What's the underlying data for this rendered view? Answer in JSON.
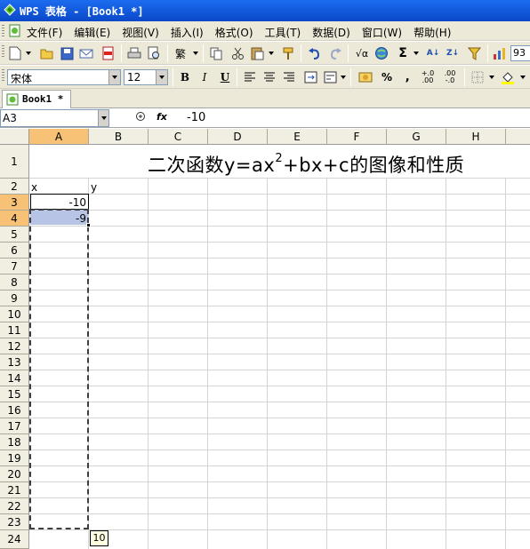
{
  "window": {
    "title": "WPS 表格 - [Book1 *]"
  },
  "menu": {
    "items": [
      "文件(F)",
      "编辑(E)",
      "视图(V)",
      "插入(I)",
      "格式(O)",
      "工具(T)",
      "数据(D)",
      "窗口(W)",
      "帮助(H)"
    ]
  },
  "toolbar": {
    "zoom": "93",
    "font_name": "宋体",
    "font_size": "12",
    "bold_label": "B",
    "italic_label": "I",
    "underline_label": "U",
    "percent_label": "%",
    "comma_label": "‚",
    "sum_label": "Σ",
    "sqrt_label": "√α",
    "lang_label": "繁"
  },
  "doc_tab": {
    "label": "Book1 *"
  },
  "formula_bar": {
    "name_box": "A3",
    "fx_label": "fx",
    "value": "-10"
  },
  "sheet": {
    "columns": [
      "A",
      "B",
      "C",
      "D",
      "E",
      "F",
      "G",
      "H"
    ],
    "selected_column": "A",
    "rows": [
      "1",
      "2",
      "3",
      "4",
      "5",
      "6",
      "7",
      "8",
      "9",
      "10",
      "11",
      "12",
      "13",
      "14",
      "15",
      "16",
      "17",
      "18",
      "19",
      "20",
      "21",
      "22",
      "23",
      "24"
    ],
    "selected_rows": [
      "3",
      "4"
    ],
    "title_main": "二次函数y=ax",
    "title_sup": "2",
    "title_rest": "+bx+c的图像和性质",
    "cells": {
      "A2": "x",
      "B2": "y",
      "A3": "-10",
      "A4": "-9"
    },
    "fill_tooltip": "10"
  }
}
